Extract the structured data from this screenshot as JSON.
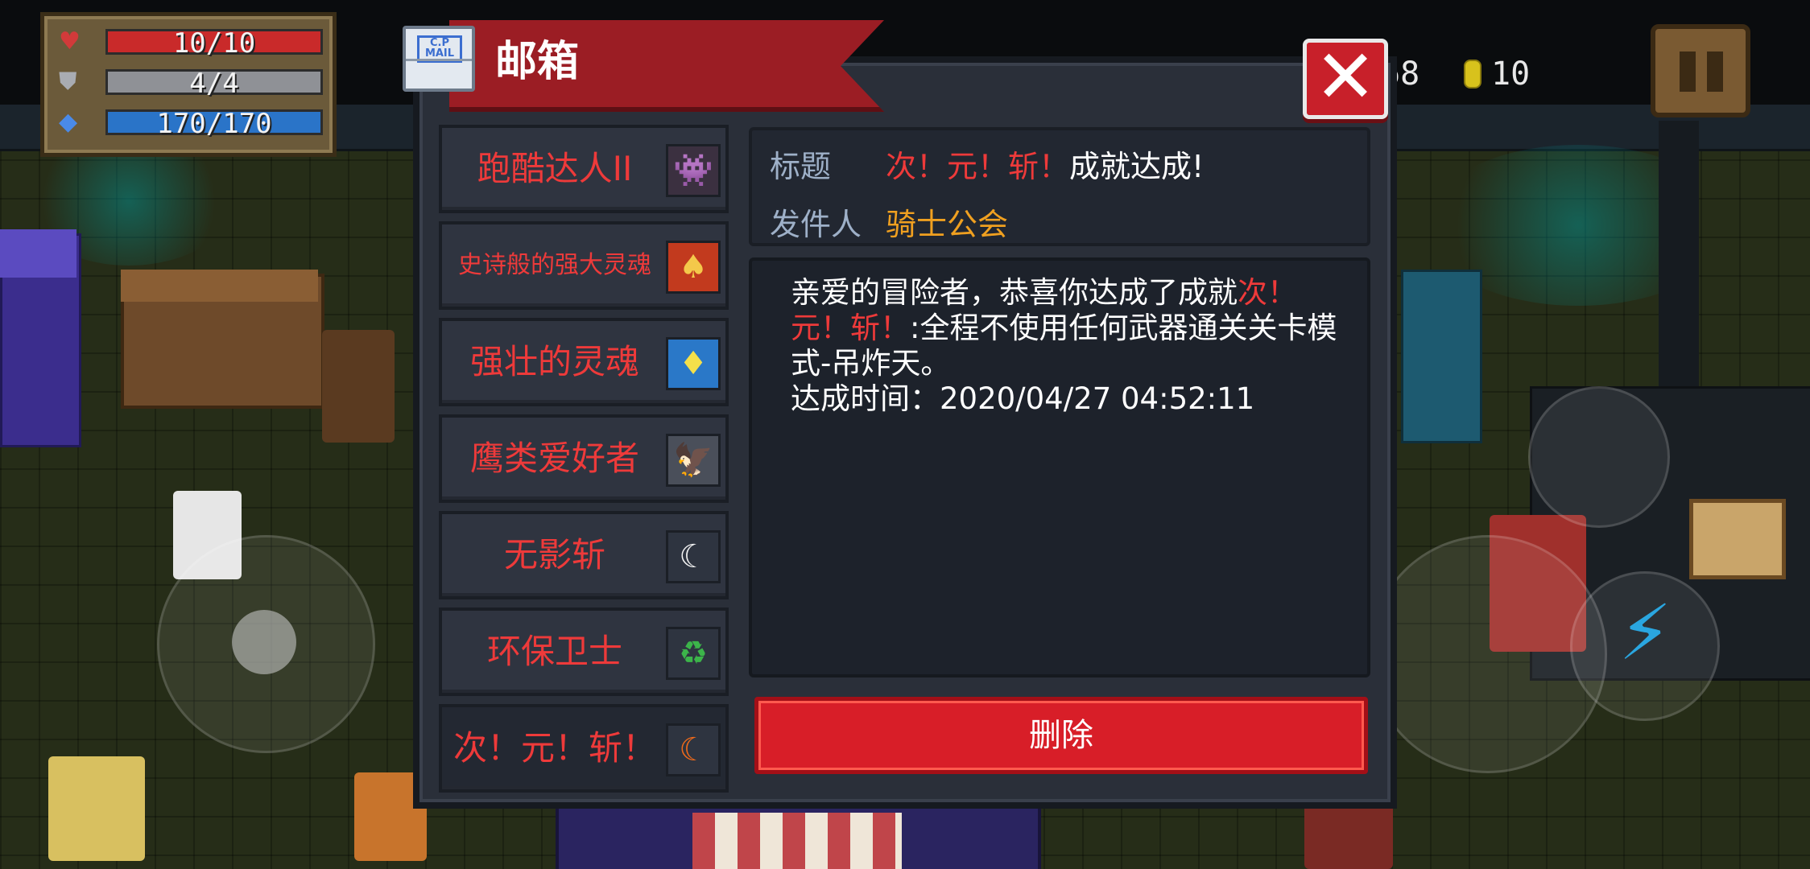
{
  "hud": {
    "hp": "10/10",
    "armor": "4/4",
    "energy": "170/170",
    "gems": "68",
    "coins": "10",
    "hp_fill": 1.0,
    "armor_fill": 1.0,
    "energy_fill": 1.0
  },
  "mailbox": {
    "title": "邮箱",
    "close_icon": "✕",
    "items": [
      {
        "label": "跑酷达人II",
        "icon": "monster-icon"
      },
      {
        "label": "史诗般的强大灵魂",
        "icon": "red-card-icon"
      },
      {
        "label": "强壮的灵魂",
        "icon": "blue-card-icon"
      },
      {
        "label": "鹰类爱好者",
        "icon": "eagle-icon"
      },
      {
        "label": "无影斩",
        "icon": "white-moon-slash-icon"
      },
      {
        "label": "环保卫士",
        "icon": "recycle-icon"
      },
      {
        "label": "次！元！斩！",
        "icon": "orange-moon-slash-icon"
      }
    ],
    "detail": {
      "title_label": "标题",
      "title_highlight": "次！元！斩！",
      "title_rest": "成就达成!",
      "sender_label": "发件人",
      "sender": "骑士公会",
      "body_prefix": "亲爱的冒险者，恭喜你达成了成就",
      "body_highlight": "次！元！斩！",
      "body_rest": ":全程不使用任何武器通关关卡模式-吊炸天。",
      "time_line": "达成时间：2020/04/27 04:52:11"
    },
    "delete_label": "删除"
  },
  "colors": {
    "highlight_red": "#ee3a3a",
    "sender_orange": "#f0a020",
    "delete_red": "#d81e28",
    "ribbon_red": "#9b1d24"
  }
}
